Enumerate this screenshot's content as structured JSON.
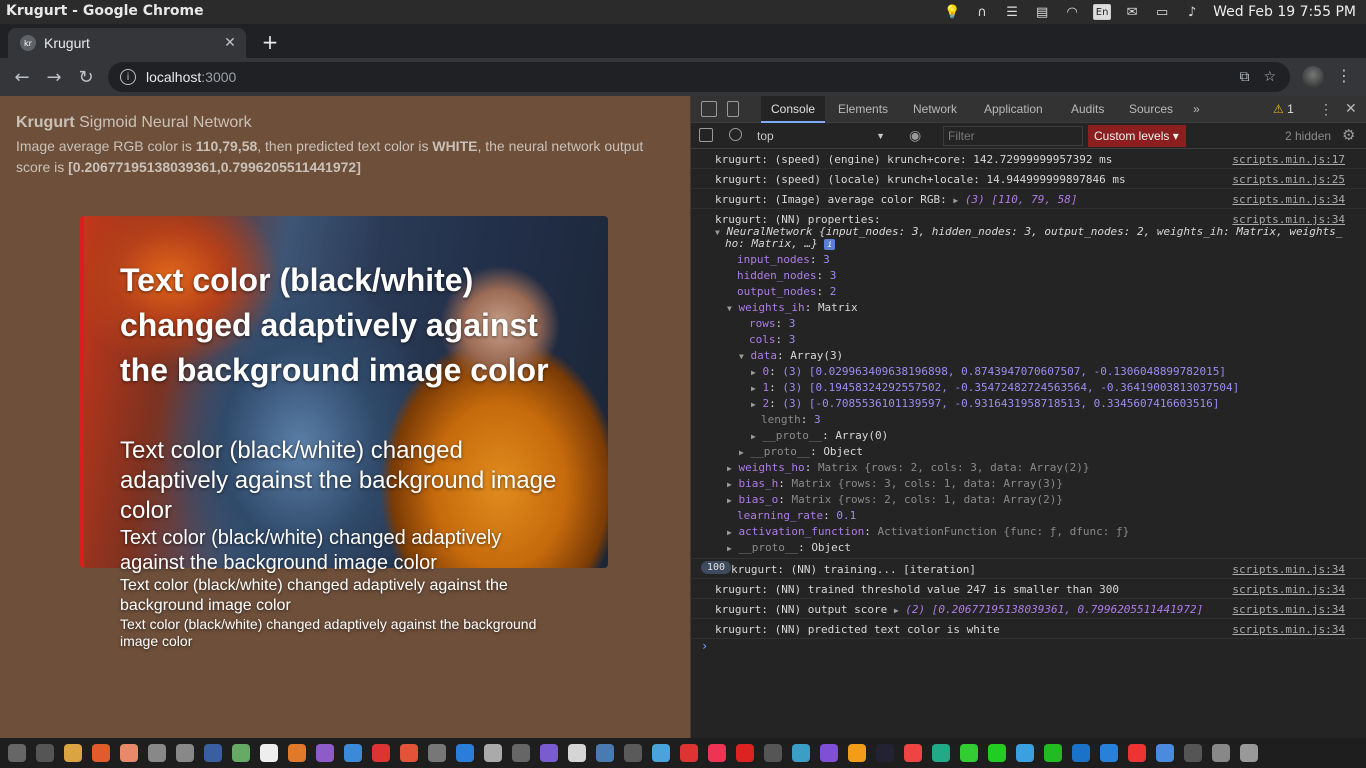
{
  "os": {
    "window_title": "Krugurt - Google Chrome",
    "keyboard_layout": "En",
    "clock": "Wed Feb 19  7:55 PM"
  },
  "browser": {
    "tab_title": "Krugurt",
    "tab_favicon_text": "kr",
    "url_host": "localhost",
    "url_port": ":3000"
  },
  "page": {
    "heading_brand": "Krugurt",
    "heading_rest": " Sigmoid Neural Network",
    "desc_prefix": "Image average RGB color is ",
    "desc_rgb": "110,79,58",
    "desc_middle": ", then predicted text color is ",
    "desc_color": "WHITE",
    "desc_middle2": ", the neural network output score is ",
    "desc_score": "[0.20677195138039361,0.7996205511441972]",
    "overlay_text": "Text color (black/white) changed adaptively against the background image color",
    "background_color": "#6e4f3a"
  },
  "devtools": {
    "tabs": [
      "Console",
      "Elements",
      "Network",
      "Application",
      "Audits",
      "Sources"
    ],
    "more_tabs": "»",
    "warning_count": "1",
    "context": "top",
    "filter_placeholder": "Filter",
    "levels": "Custom levels",
    "hidden": "2 hidden",
    "console": [
      {
        "text": "krugurt: (speed) (engine) krunch+core: 142.72999999957392 ms",
        "src": "scripts.min.js:17"
      },
      {
        "text": "krugurt: (speed) (locale) krunch+locale: 14.944999999897846 ms",
        "src": "scripts.min.js:25"
      },
      {
        "text": "krugurt: (Image) average color RGB: ",
        "arr": "(3) [110, 79, 58]",
        "src": "scripts.min.js:34"
      },
      {
        "text": "krugurt: (NN) properties:",
        "src": "scripts.min.js:34"
      },
      {
        "text": "krugurt: (NN) training... [iteration]",
        "badge": "100",
        "src": "scripts.min.js:34"
      },
      {
        "text": "krugurt: (NN) trained threshold value 247 is smaller than 300",
        "src": "scripts.min.js:34"
      },
      {
        "text": "krugurt: (NN) output score ",
        "arr": "(2) [0.20677195138039361, 0.7996205511441972]",
        "src": "scripts.min.js:34"
      },
      {
        "text": "krugurt: (NN) predicted text color is white",
        "src": "scripts.min.js:34"
      }
    ],
    "nn_summary_a": "NeuralNetwork {input_nodes: 3, hidden_nodes: 3, output_nodes: 2, weights_ih: Matrix, weights_",
    "nn_summary_b": "ho: Matrix, …}",
    "tree": [
      {
        "key": "input_nodes",
        "val": "3"
      },
      {
        "key": "hidden_nodes",
        "val": "3"
      },
      {
        "key": "output_nodes",
        "val": "2"
      },
      {
        "key": "weights_ih",
        "val": "Matrix"
      },
      {
        "key": "rows",
        "val": "3"
      },
      {
        "key": "cols",
        "val": "3"
      },
      {
        "key": "data",
        "val": "Array(3)"
      },
      {
        "key": "0",
        "val": "(3) [0.029963409638196898, 0.8743947070607507, -0.1306048899782015]"
      },
      {
        "key": "1",
        "val": "(3) [0.19458324292557502, -0.35472482724563564, -0.36419003813037504]"
      },
      {
        "key": "2",
        "val": "(3) [-0.7085536101139597, -0.9316431958718513, 0.3345607416603516]"
      },
      {
        "key": "length",
        "val": "3"
      },
      {
        "key": "__proto__",
        "val": "Array(0)"
      },
      {
        "key": "__proto__",
        "val": "Object"
      },
      {
        "key": "weights_ho",
        "val": "Matrix {rows: 2, cols: 3, data: Array(2)}"
      },
      {
        "key": "bias_h",
        "val": "Matrix {rows: 3, cols: 1, data: Array(3)}"
      },
      {
        "key": "bias_o",
        "val": "Matrix {rows: 2, cols: 1, data: Array(2)}"
      },
      {
        "key": "learning_rate",
        "val": "0.1"
      },
      {
        "key": "activation_function",
        "val": "ActivationFunction {func: ƒ, dfunc: ƒ}"
      },
      {
        "key": "__proto__",
        "val": "Object"
      }
    ]
  }
}
